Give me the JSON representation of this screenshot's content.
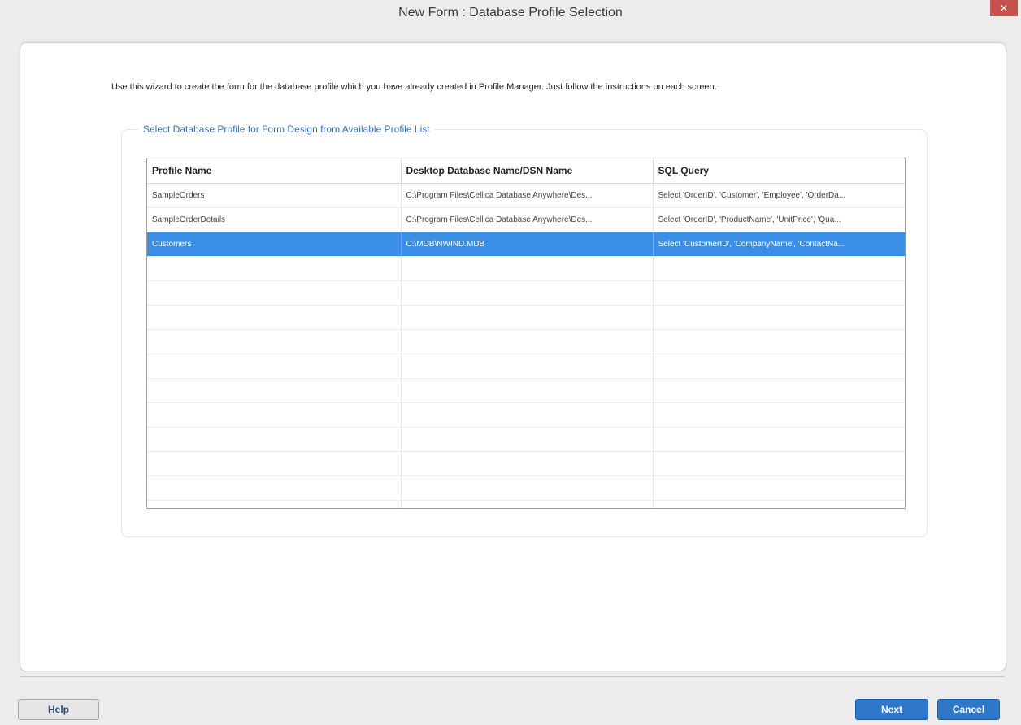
{
  "window": {
    "title": "New Form : Database Profile Selection",
    "close_label": "✕"
  },
  "intro_text": "Use this wizard to create the form for the database profile which you have already created in Profile Manager. Just follow the instructions on each screen.",
  "group_title": "Select Database Profile for Form Design from Available Profile  List",
  "table": {
    "headers": [
      "Profile Name",
      "Desktop Database Name/DSN Name",
      "SQL Query"
    ],
    "rows": [
      [
        "SampleOrders",
        "C:\\Program Files\\Cellica Database Anywhere\\Des...",
        "Select 'OrderID', 'Customer', 'Employee', 'OrderDa..."
      ],
      [
        "SampleOrderDetails",
        "C:\\Program Files\\Cellica Database Anywhere\\Des...",
        "Select 'OrderID', 'ProductName', 'UnitPrice', 'Qua..."
      ],
      [
        "Customers",
        "C:\\MDB\\NWIND.MDB",
        "Select 'CustomerID', 'CompanyName', 'ContactNa..."
      ]
    ],
    "selected_row": 2
  },
  "buttons": {
    "help": "Help",
    "next": "Next",
    "cancel": "Cancel"
  },
  "colors": {
    "selection": "#3a8ee6",
    "primary_button": "#2f78c7",
    "legend_text": "#3a73b8",
    "close_button": "#c7514d"
  }
}
